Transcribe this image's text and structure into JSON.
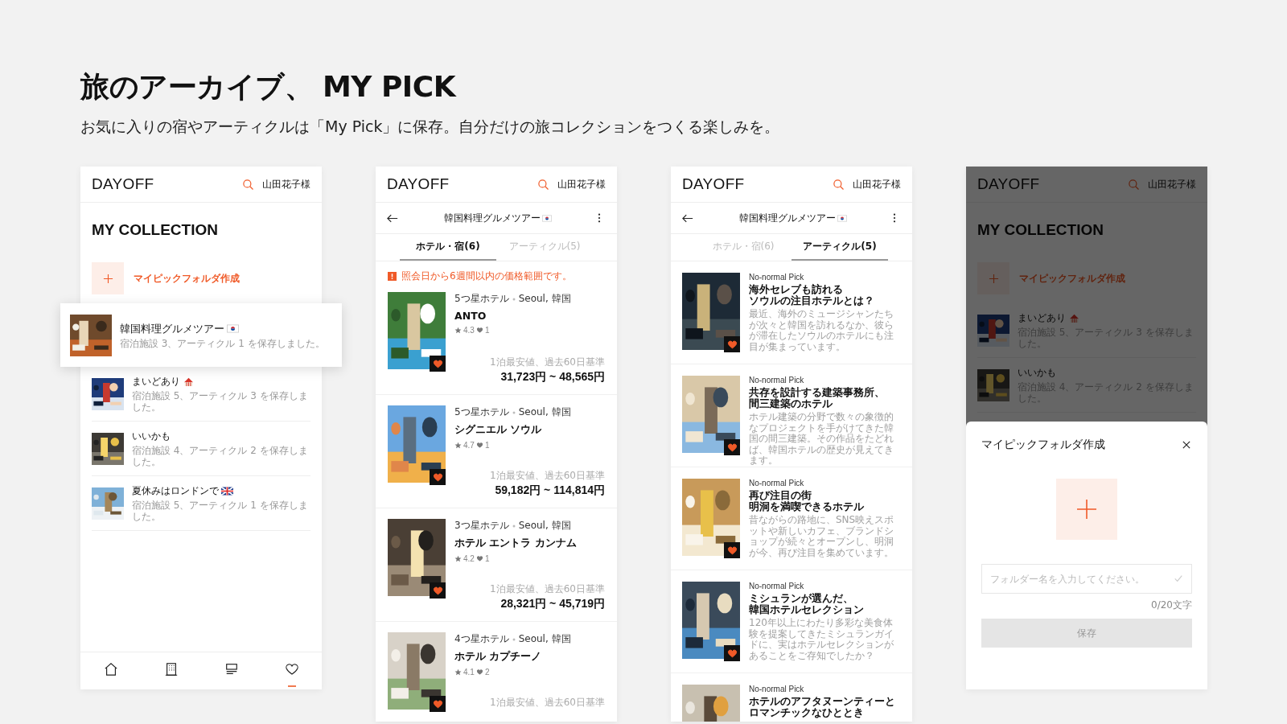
{
  "heading": {
    "title": "旅のアーカイブ、 MY PICK",
    "subtitle": "お気に入りの宿やアーティクルは「My Pick」に保存。自分だけの旅コレクションをつくる楽しみを。"
  },
  "screens": [
    {
      "kind": "collection",
      "header": {
        "logo": "DAYOFF",
        "user": "山田花子様"
      },
      "title": "MY COLLECTION",
      "create_label": "マイピックフォルダ作成",
      "folders": [
        {
          "name": "韓国料理グルメツアー",
          "badge": {
            "kind": "kr_flag"
          },
          "summary": "宿泊施設 3、アーティクル 1 を保存しました。",
          "raised": true
        },
        {
          "name": "まいどあり",
          "badge": {
            "kind": "tent"
          },
          "summary": "宿泊施設 5、アーティクル 3 を保存しました。",
          "raised": false
        },
        {
          "name": "いいかも",
          "summary": "宿泊施設 4、アーティクル 2 を保存しました。",
          "raised": false
        },
        {
          "name": "夏休みはロンドンで",
          "badge": {
            "kind": "uk_flag"
          },
          "summary": "宿泊施設 5、アーティクル 1 を保存しました。",
          "raised": false
        }
      ],
      "nav": [
        {
          "kind": "home",
          "selected": false
        },
        {
          "kind": "building",
          "selected": false
        },
        {
          "kind": "articles",
          "selected": false
        },
        {
          "kind": "picks",
          "selected": true
        }
      ]
    },
    {
      "kind": "hotels",
      "header": {
        "logo": "DAYOFF",
        "user": "山田花子様"
      },
      "subheader": {
        "title": "韓国料理グルメツアー",
        "badge": {
          "kind": "kr_flag"
        }
      },
      "tabs": [
        {
          "label": "ホテル・宿(6)",
          "selected": true
        },
        {
          "label": "アーティクル(5)",
          "selected": false
        }
      ],
      "notice": "照会日から6週間以内の価格範囲です。",
      "hotels": [
        {
          "category": "5つ星ホテル",
          "location": "Seoul, 韓国",
          "name": "ANTO",
          "rating": "4.3",
          "likes": "1",
          "price_note": "1泊最安値、過去60日基準",
          "price": "31,723円 ~ 48,565円",
          "saved": true
        },
        {
          "category": "5つ星ホテル",
          "location": "Seoul, 韓国",
          "name": "シグニエル ソウル",
          "rating": "4.7",
          "likes": "1",
          "price_note": "1泊最安値、過去60日基準",
          "price": "59,182円 ~ 114,814円",
          "saved": true
        },
        {
          "category": "3つ星ホテル",
          "location": "Seoul, 韓国",
          "name": "ホテル エントラ カンナム",
          "rating": "4.2",
          "likes": "1",
          "price_note": "1泊最安値、過去60日基準",
          "price": "28,321円 ~ 45,719円",
          "saved": true
        },
        {
          "category": "4つ星ホテル",
          "location": "Seoul, 韓国",
          "name": "ホテル カプチーノ",
          "rating": "4.1",
          "likes": "2",
          "price_note": "1泊最安値、過去60日基準",
          "saved": true
        }
      ]
    },
    {
      "kind": "articles",
      "header": {
        "logo": "DAYOFF",
        "user": "山田花子様"
      },
      "subheader": {
        "title": "韓国料理グルメツアー",
        "badge": {
          "kind": "kr_flag"
        }
      },
      "tabs": [
        {
          "label": "ホテル・宿(6)",
          "selected": false
        },
        {
          "label": "アーティクル(5)",
          "selected": true
        }
      ],
      "articles": [
        {
          "label": "No-normal Pick",
          "title_lines": [
            "海外セレブも訪れる",
            "ソウルの注目ホテルとは？"
          ],
          "description": "最近、海外のミュージシャンたちが次々と韓国を訪れるなか、彼らが滞在したソウルのホテルにも注目が集まっています。",
          "saved": true
        },
        {
          "label": "No-normal Pick",
          "title_lines": [
            "共存を設計する建築事務所、",
            "間三建築のホテル"
          ],
          "description": "ホテル建築の分野で数々の象徴的なプロジェクトを手がけてきた韓国の間三建築。その作品をたどれば、韓国ホテルの歴史が見えてきます。",
          "saved": true
        },
        {
          "label": "No-normal Pick",
          "title_lines": [
            "再び注目の街",
            "明洞を満喫できるホテル"
          ],
          "description": "昔ながらの路地に、SNS映えスポットや新しいカフェ、ブランドショップが続々とオープンし、明洞が今、再び注目を集めています。",
          "saved": true
        },
        {
          "label": "No-normal Pick",
          "title_lines": [
            "ミシュランが選んだ、",
            "韓国ホテルセレクション"
          ],
          "description": "120年以上にわたり多彩な美食体験を提案してきたミシュランガイドに、実はホテルセレクションがあることをご存知でしたか？",
          "saved": true
        },
        {
          "label": "No-normal Pick",
          "title_lines": [
            "ホテルのアフタヌーンティーと",
            "ロマンチックなひととき"
          ]
        }
      ]
    },
    {
      "kind": "collection",
      "header": {
        "logo": "DAYOFF",
        "user": "山田花子様"
      },
      "title": "MY COLLECTION",
      "create_label": "マイピックフォルダ作成",
      "folders": [
        {
          "name": "まいどあり",
          "badge": {
            "kind": "tent"
          },
          "summary": "宿泊施設 5、アーティクル 3 を保存しました。",
          "raised": false
        },
        {
          "name": "いいかも",
          "summary": "宿泊施設 4、アーティクル 2 を保存しました。",
          "raised": false
        }
      ],
      "dialog": {
        "title": "マイピックフォルダ作成",
        "placeholder": "フォルダー名を入力してください。",
        "counter": "0/20文字",
        "button": "保存",
        "button_disabled": true
      }
    }
  ]
}
